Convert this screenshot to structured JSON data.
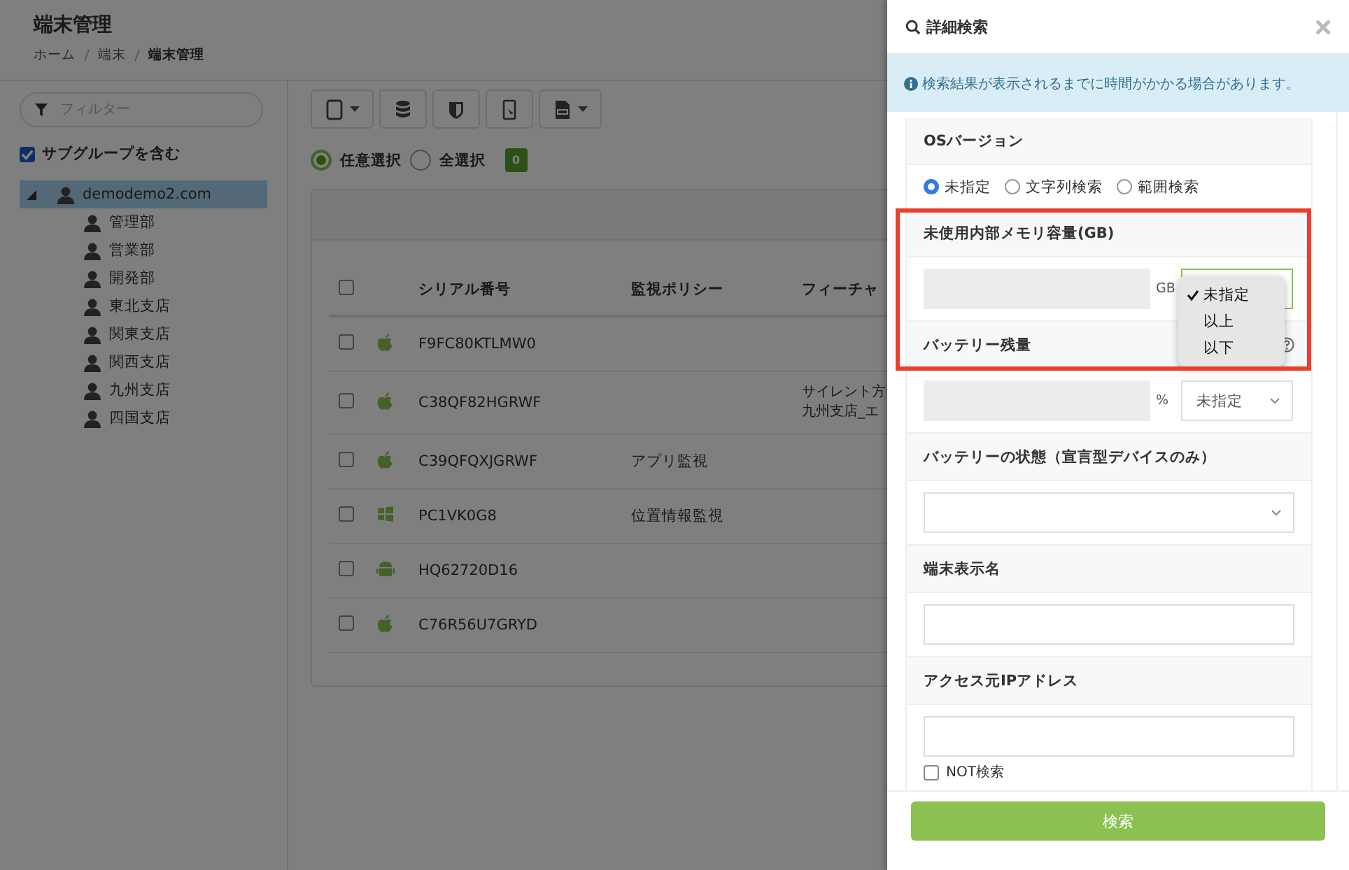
{
  "page": {
    "title": "端末管理",
    "breadcrumb": [
      "ホーム",
      "端末",
      "端末管理"
    ]
  },
  "sidebar": {
    "filter": {
      "placeholder": "フィルター"
    },
    "include_subgroups": {
      "label": "サブグループを含む",
      "checked": true
    },
    "tree": [
      {
        "label": "demodemo2.com",
        "expanded": true,
        "selected": true,
        "children": [
          {
            "label": "管理部",
            "selected": false
          },
          {
            "label": "営業部",
            "selected": false
          },
          {
            "label": "開発部",
            "selected": false
          },
          {
            "label": "東北支店",
            "selected": false
          },
          {
            "label": "関東支店",
            "selected": false
          },
          {
            "label": "関西支店",
            "selected": false
          },
          {
            "label": "九州支店",
            "selected": false
          },
          {
            "label": "四国支店",
            "selected": false
          }
        ]
      }
    ]
  },
  "selection": {
    "options": [
      {
        "label": "任意選択",
        "selected": true
      },
      {
        "label": "全選択",
        "selected": false
      }
    ],
    "count": "0"
  },
  "table": {
    "header_checked": false,
    "columns": [
      "シリアル番号",
      "監視ポリシー",
      "フィーチャ"
    ],
    "rows": [
      {
        "checked": false,
        "kind": "apple",
        "serial": "F9FC80KTLMW0",
        "policy": "",
        "feature": []
      },
      {
        "checked": false,
        "kind": "apple",
        "serial": "C38QF82HGRWF",
        "policy": "",
        "feature": [
          "サイレント方",
          "九州支店_エ"
        ]
      },
      {
        "checked": false,
        "kind": "apple",
        "serial": "C39QFQXJGRWF",
        "policy": "アプリ監視",
        "feature": []
      },
      {
        "checked": false,
        "kind": "windows",
        "serial": "PC1VK0G8",
        "policy": "位置情報監視",
        "feature": []
      },
      {
        "checked": false,
        "kind": "android",
        "serial": "HQ62720D16",
        "policy": "",
        "feature": []
      },
      {
        "checked": false,
        "kind": "apple",
        "serial": "C76R56U7GRYD",
        "policy": "",
        "feature": []
      }
    ]
  },
  "search_panel": {
    "title": "詳細検索",
    "notice": "検索結果が表示されるまでに時間がかかる場合があります。",
    "sections": [
      {
        "kind": "radios",
        "title": "OSバージョン",
        "options": [
          {
            "label": "未指定",
            "selected": true
          },
          {
            "label": "文字列検索",
            "selected": false
          },
          {
            "label": "範囲検索",
            "selected": false
          }
        ]
      },
      {
        "kind": "amount",
        "title": "未使用内部メモリ容量(GB)",
        "unit": "GB",
        "focused": true
      },
      {
        "kind": "amount",
        "title": "バッテリー残量",
        "unit": "%",
        "select_value": "未指定",
        "help": true,
        "focused": false
      },
      {
        "kind": "select",
        "title": "バッテリーの状態（宣言型デバイスのみ）"
      },
      {
        "kind": "text",
        "title": "端末表示名"
      },
      {
        "kind": "text",
        "title": "アクセス元IPアドレス",
        "not_search": {
          "label": "NOT検索",
          "checked": false
        }
      }
    ],
    "dropdown": {
      "options": [
        {
          "label": "未指定",
          "selected": true
        },
        {
          "label": "以上",
          "selected": false
        },
        {
          "label": "以下",
          "selected": false
        }
      ]
    },
    "submit": "検索"
  }
}
